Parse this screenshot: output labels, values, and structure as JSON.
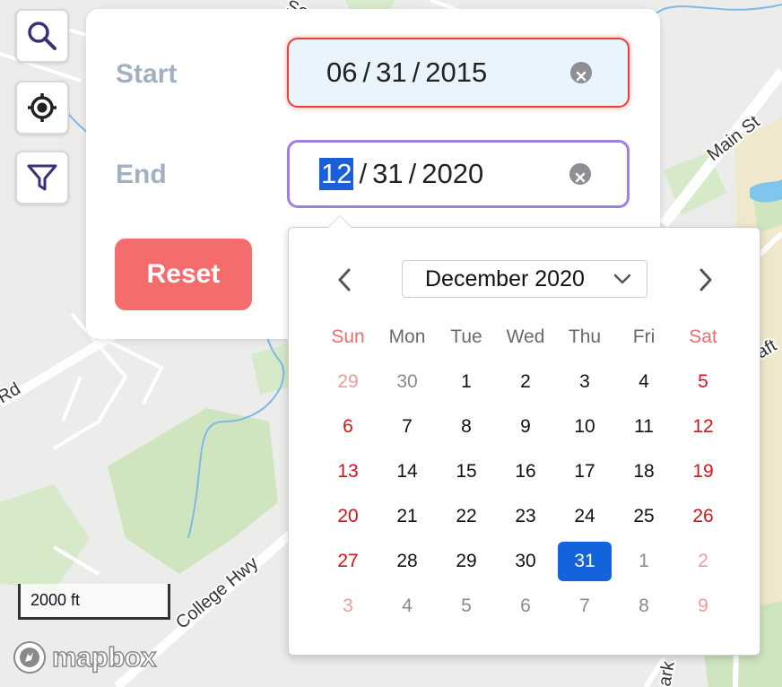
{
  "map": {
    "street_labels": [
      "Main St",
      "College Hwy",
      "Rd",
      "So",
      "aft",
      "ark"
    ],
    "scale_label": "2000 ft",
    "logo_text": "mapbox"
  },
  "controls": {
    "icons": [
      "search-icon",
      "locate-icon",
      "filter-icon"
    ]
  },
  "panel": {
    "start_label": "Start",
    "end_label": "End",
    "start_date": {
      "month": "06",
      "day": "31",
      "year": "2015",
      "separator": "/"
    },
    "end_date": {
      "month": "12",
      "day": "31",
      "year": "2020",
      "separator": "/",
      "selected_segment": "month"
    },
    "reset_label": "Reset"
  },
  "calendar": {
    "month_label": "December 2020",
    "weekdays": [
      "Sun",
      "Mon",
      "Tue",
      "Wed",
      "Thu",
      "Fri",
      "Sat"
    ],
    "weeks": [
      [
        "29",
        "30",
        "1",
        "2",
        "3",
        "4",
        "5"
      ],
      [
        "6",
        "7",
        "8",
        "9",
        "10",
        "11",
        "12"
      ],
      [
        "13",
        "14",
        "15",
        "16",
        "17",
        "18",
        "19"
      ],
      [
        "20",
        "21",
        "22",
        "23",
        "24",
        "25",
        "26"
      ],
      [
        "27",
        "28",
        "29",
        "30",
        "31",
        "1",
        "2"
      ],
      [
        "3",
        "4",
        "5",
        "6",
        "7",
        "8",
        "9"
      ]
    ],
    "selected_day": "31"
  },
  "colors": {
    "accent": "#1463dc",
    "reset": "#f46c6c",
    "weekend": "#d9121b",
    "error_border": "#ec3e3e",
    "focus_border": "#9f7ee6"
  }
}
